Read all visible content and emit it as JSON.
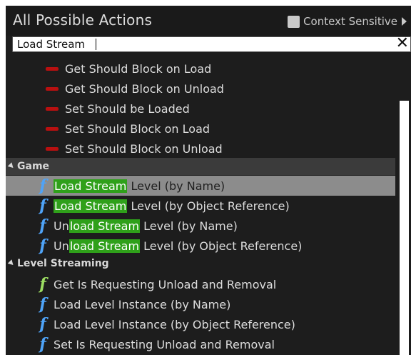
{
  "header": {
    "title": "All Possible Actions",
    "context_label": "Context Sensitive"
  },
  "search": {
    "value": "Load Stream",
    "clear": "✕"
  },
  "items_top": [
    {
      "label": "Get Should Block on Load",
      "icon": "red-node-icon"
    },
    {
      "label": "Get Should Block on Unload",
      "icon": "red-node-icon"
    },
    {
      "label": "Set Should be Loaded",
      "icon": "red-node-icon"
    },
    {
      "label": "Set Should Block on Load",
      "icon": "red-node-icon"
    },
    {
      "label": "Set Should Block on Unload",
      "icon": "red-node-icon"
    }
  ],
  "categories": {
    "game": "Game",
    "level_streaming": "Level Streaming"
  },
  "game_items": [
    {
      "pre": "",
      "match": "Load Stream",
      "post": " Level (by Name)",
      "icon": "function-icon",
      "selected": true
    },
    {
      "pre": "",
      "match": "Load Stream",
      "post": " Level (by Object Reference)",
      "icon": "function-icon"
    },
    {
      "pre": "Un",
      "match": "load Stream",
      "post": " Level (by Name)",
      "icon": "function-icon"
    },
    {
      "pre": "Un",
      "match": "load Stream",
      "post": " Level (by Object Reference)",
      "icon": "function-icon"
    }
  ],
  "level_streaming_items": [
    {
      "label": "Get Is Requesting Unload and Removal",
      "icon": "pure-function-icon"
    },
    {
      "label": "Load Level Instance (by Name)",
      "icon": "function-icon"
    },
    {
      "label": "Load Level Instance (by Object Reference)",
      "icon": "function-icon"
    },
    {
      "label": "Set Is Requesting Unload and Removal",
      "icon": "function-icon"
    }
  ],
  "glyphs": {
    "function": "f"
  },
  "colors": {
    "function_icon": "#4fa3f7",
    "pure_function_icon": "#9cdc62",
    "match_highlight": "#2fa01a",
    "node_icon": "#b81010",
    "selected_row": "#8c8c8c"
  }
}
